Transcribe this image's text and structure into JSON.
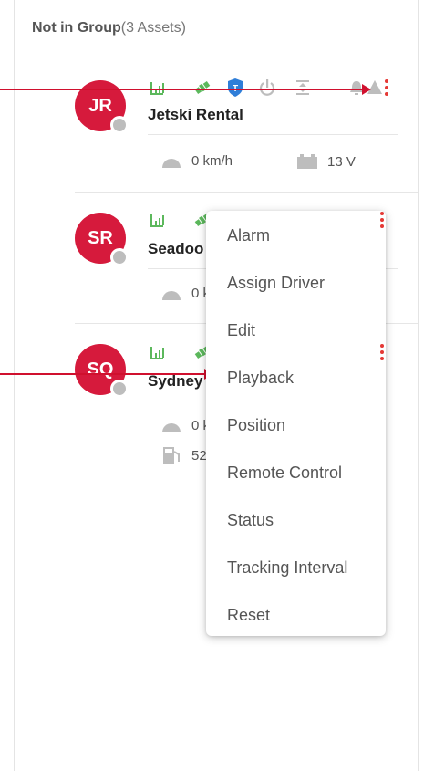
{
  "group": {
    "name": "Not in Group",
    "count": "(3 Assets)"
  },
  "assets": [
    {
      "initials": "JR",
      "name": "Jetski Rental",
      "speed": "0 km/h",
      "voltage": "13 V"
    },
    {
      "initials": "SR",
      "name": "Seadoo",
      "speed": "0 km/h"
    },
    {
      "initials": "SQ",
      "name": "Sydney",
      "speed": "0 km/h",
      "fuel": "52"
    }
  ],
  "menu": {
    "items": [
      "Alarm",
      "Assign Driver",
      "Edit",
      "Playback",
      "Position",
      "Remote Control",
      "Status",
      "Tracking Interval",
      "Reset"
    ]
  },
  "colors": {
    "brand_red": "#d61a3c",
    "signal_green": "#5cb85c",
    "shield_blue": "#2f7ed8",
    "kebab_red": "#e53935",
    "callout_red": "#d0102e"
  }
}
